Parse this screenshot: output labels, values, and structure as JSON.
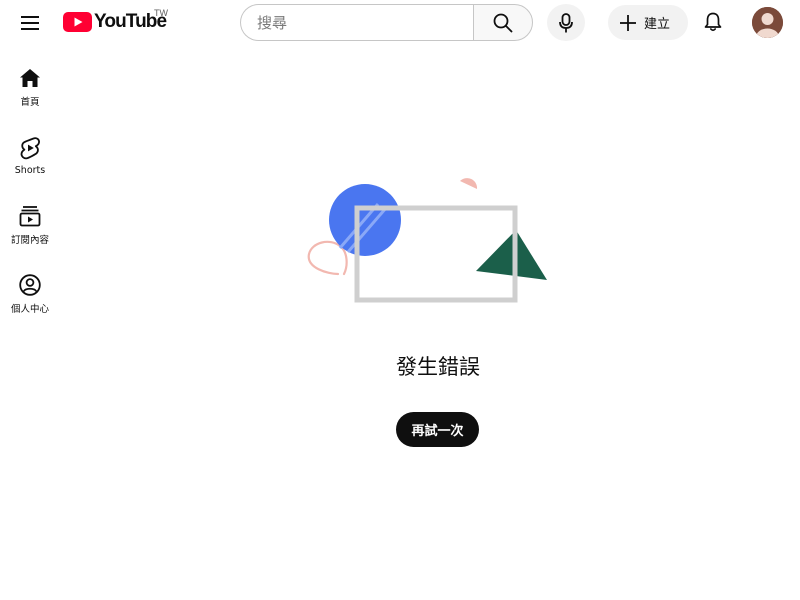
{
  "header": {
    "logo_text": "YouTube",
    "logo_country": "TW",
    "search_placeholder": "搜尋",
    "create_label": "建立",
    "icons": {
      "menu": "hamburger-menu-icon",
      "search": "search-icon",
      "mic": "microphone-icon",
      "create": "plus-icon",
      "notifications": "bell-icon",
      "avatar": "avatar"
    }
  },
  "sidebar": {
    "items": [
      {
        "label": "首頁",
        "icon": "home-icon"
      },
      {
        "label": "Shorts",
        "icon": "shorts-icon"
      },
      {
        "label": "訂閱內容",
        "icon": "subscriptions-icon"
      },
      {
        "label": "個人中心",
        "icon": "account-icon"
      }
    ]
  },
  "main": {
    "error_title": "發生錯誤",
    "retry_label": "再試一次"
  },
  "colors": {
    "brand_red": "#ff0033",
    "illustration_blue": "#4a76f0",
    "illustration_green": "#1b5f4a",
    "illustration_pink": "#f2b8b0",
    "frame_gray": "#cfcfcf",
    "button_dark": "#0f0f0f"
  }
}
